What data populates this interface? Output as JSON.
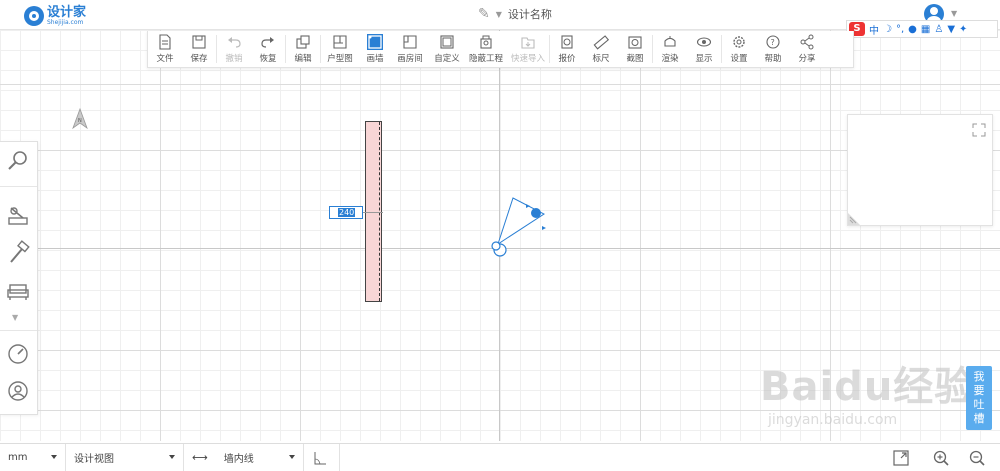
{
  "header": {
    "logo_cn": "设计家",
    "logo_en": "Shejijia.com",
    "design_name": "设计名称"
  },
  "ime": {
    "s": "S",
    "mode": "中"
  },
  "toolbar": [
    {
      "label": "文件",
      "icon": "file-icon"
    },
    {
      "label": "保存",
      "icon": "save-icon"
    },
    {
      "label": "撤销",
      "icon": "undo-icon",
      "disabled": true
    },
    {
      "label": "恢复",
      "icon": "redo-icon"
    },
    {
      "label": "编辑",
      "icon": "edit-icon"
    },
    {
      "label": "户型图",
      "icon": "floorplan-icon"
    },
    {
      "label": "画墙",
      "icon": "draw-wall-icon",
      "active": true
    },
    {
      "label": "画房间",
      "icon": "draw-room-icon"
    },
    {
      "label": "自定义",
      "icon": "custom-icon"
    },
    {
      "label": "隐蔽工程",
      "icon": "hidden-works-icon"
    },
    {
      "label": "快速导入",
      "icon": "quick-import-icon",
      "disabled": true
    },
    {
      "label": "报价",
      "icon": "quote-icon"
    },
    {
      "label": "标尺",
      "icon": "ruler-icon"
    },
    {
      "label": "截图",
      "icon": "screenshot-icon"
    },
    {
      "label": "渲染",
      "icon": "render-icon"
    },
    {
      "label": "显示",
      "icon": "display-icon"
    },
    {
      "label": "设置",
      "icon": "settings-icon"
    },
    {
      "label": "帮助",
      "icon": "help-icon"
    },
    {
      "label": "分享",
      "icon": "share-icon"
    }
  ],
  "canvas": {
    "wall_length": "240"
  },
  "feedback": "我要吐槽",
  "watermark": {
    "big": "Baidu经验",
    "small": "jingyan.baidu.com"
  },
  "bottom": {
    "unit": "mm",
    "view": "设计视图",
    "wall_line": "墙内线"
  },
  "colors": {
    "accent": "#2a7fd4",
    "wall_fill": "#f8d6d6",
    "feedback_bg": "#5aacee"
  }
}
